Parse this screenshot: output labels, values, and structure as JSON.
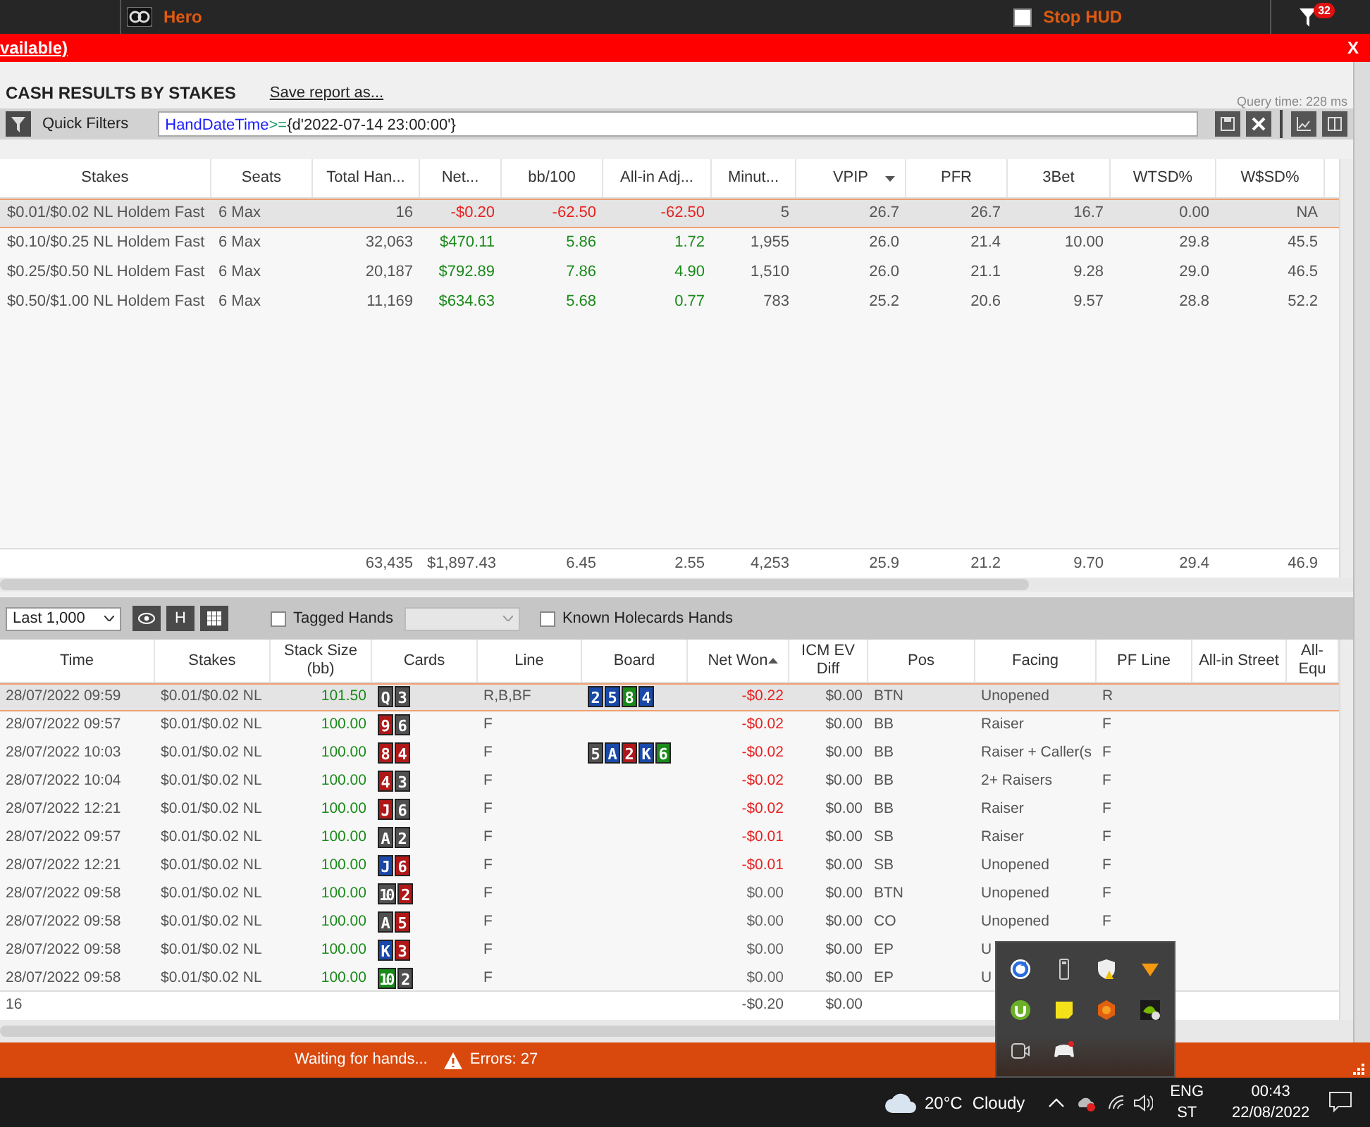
{
  "app_bar": {
    "user": "Hero",
    "stop_hud": {
      "label": "Stop HUD",
      "checked": false
    },
    "notification_count": "32"
  },
  "alert_bar": {
    "text": "vailable)",
    "close": "X"
  },
  "report": {
    "title": "CASH RESULTS BY STAKES",
    "save_link": "Save report as...",
    "query_time": "Query time: 228 ms"
  },
  "quick_filters": {
    "label": "Quick Filters",
    "tokens": [
      {
        "text": "HandDateTime",
        "kind": "field"
      },
      {
        "text": ">=",
        "kind": "operator"
      },
      {
        "text": "{d'2022-07-14 23:00:00'}",
        "kind": "literal"
      }
    ]
  },
  "stakes_table": {
    "columns": [
      {
        "label": "Stakes",
        "sorted": false
      },
      {
        "label": "Seats",
        "sorted": false
      },
      {
        "label": "Total Han...",
        "sorted": false
      },
      {
        "label": "Net...",
        "sorted": false
      },
      {
        "label": "bb/100",
        "sorted": false
      },
      {
        "label": "All-in Adj...",
        "sorted": false
      },
      {
        "label": "Minut...",
        "sorted": false
      },
      {
        "label": "VPIP",
        "sorted": true,
        "descending": true
      },
      {
        "label": "PFR",
        "sorted": false
      },
      {
        "label": "3Bet",
        "sorted": false
      },
      {
        "label": "WTSD%",
        "sorted": false
      },
      {
        "label": "W$SD%",
        "sorted": false
      }
    ],
    "rows": [
      {
        "stakes": "$0.01/$0.02 NL Holdem Fast",
        "seats": "6 Max",
        "total_hands": "16",
        "net": "-$0.20",
        "bb100": "-62.50",
        "allin_adj": "-62.50",
        "minutes": "5",
        "vpip": "26.7",
        "pfr": "26.7",
        "threebet": "16.7",
        "wtsd": "0.00",
        "wssd": "NA",
        "loss": true,
        "selected": true
      },
      {
        "stakes": "$0.10/$0.25 NL Holdem Fast",
        "seats": "6 Max",
        "total_hands": "32,063",
        "net": "$470.11",
        "bb100": "5.86",
        "allin_adj": "1.72",
        "minutes": "1,955",
        "vpip": "26.0",
        "pfr": "21.4",
        "threebet": "10.00",
        "wtsd": "29.8",
        "wssd": "45.5",
        "loss": false,
        "selected": false
      },
      {
        "stakes": "$0.25/$0.50 NL Holdem Fast",
        "seats": "6 Max",
        "total_hands": "20,187",
        "net": "$792.89",
        "bb100": "7.86",
        "allin_adj": "4.90",
        "minutes": "1,510",
        "vpip": "26.0",
        "pfr": "21.1",
        "threebet": "9.28",
        "wtsd": "29.0",
        "wssd": "46.5",
        "loss": false,
        "selected": false
      },
      {
        "stakes": "$0.50/$1.00 NL Holdem Fast",
        "seats": "6 Max",
        "total_hands": "11,169",
        "net": "$634.63",
        "bb100": "5.68",
        "allin_adj": "0.77",
        "minutes": "783",
        "vpip": "25.2",
        "pfr": "20.6",
        "threebet": "9.57",
        "wtsd": "28.8",
        "wssd": "52.2",
        "loss": false,
        "selected": false
      }
    ],
    "totals": {
      "total_hands": "63,435",
      "net": "$1,897.43",
      "bb100": "6.45",
      "allin_adj": "2.55",
      "minutes": "4,253",
      "vpip": "25.9",
      "pfr": "21.2",
      "threebet": "9.70",
      "wtsd": "29.4",
      "wssd": "46.9"
    }
  },
  "hands_toolbar": {
    "range": "Last 1,000",
    "hud_button": "H",
    "tagged": {
      "label": "Tagged Hands",
      "checked": false
    },
    "known": {
      "label": "Known Holecards Hands",
      "checked": false
    }
  },
  "hands_table": {
    "columns": [
      {
        "label": "Time",
        "sorted": false
      },
      {
        "label": "Stakes",
        "sorted": false
      },
      {
        "label": "Stack Size (bb)",
        "sorted": false
      },
      {
        "label": "Cards",
        "sorted": false
      },
      {
        "label": "Line",
        "sorted": false
      },
      {
        "label": "Board",
        "sorted": false
      },
      {
        "label": "Net Won",
        "sorted": true,
        "descending": false
      },
      {
        "label": "ICM EV Diff",
        "sorted": false
      },
      {
        "label": "Pos",
        "sorted": false
      },
      {
        "label": "Facing",
        "sorted": false
      },
      {
        "label": "PF Line",
        "sorted": false
      },
      {
        "label": "All-in Street",
        "sorted": false
      },
      {
        "label": "All- Equ",
        "sorted": false
      }
    ],
    "rows": [
      {
        "time": "28/07/2022 09:59",
        "stakes": "$0.01/$0.02 NL",
        "stack": "101.50",
        "cards": [
          {
            "rank": "Q",
            "color": "#505050"
          },
          {
            "rank": "3",
            "color": "#505050"
          }
        ],
        "line": "R,B,BF",
        "board": [
          {
            "rank": "2",
            "color": "#1848a8"
          },
          {
            "rank": "5",
            "color": "#1848a8"
          },
          {
            "rank": "8",
            "color": "#1a8a1a"
          },
          {
            "rank": "4",
            "color": "#1848a8"
          }
        ],
        "net_won": "-$0.22",
        "icm": "$0.00",
        "pos": "BTN",
        "facing": "Unopened",
        "pf_line": "R",
        "loss": true,
        "selected": true
      },
      {
        "time": "28/07/2022 09:57",
        "stakes": "$0.01/$0.02 NL",
        "stack": "100.00",
        "cards": [
          {
            "rank": "9",
            "color": "#b01818"
          },
          {
            "rank": "6",
            "color": "#505050"
          }
        ],
        "line": "F",
        "net_won": "-$0.02",
        "icm": "$0.00",
        "pos": "BB",
        "facing": "Raiser",
        "pf_line": "F",
        "loss": true,
        "selected": false
      },
      {
        "time": "28/07/2022 10:03",
        "stakes": "$0.01/$0.02 NL",
        "stack": "100.00",
        "cards": [
          {
            "rank": "8",
            "color": "#b01818"
          },
          {
            "rank": "4",
            "color": "#b01818"
          }
        ],
        "line": "F",
        "board": [
          {
            "rank": "5",
            "color": "#505050"
          },
          {
            "rank": "A",
            "color": "#1848a8"
          },
          {
            "rank": "2",
            "color": "#b01818"
          },
          {
            "rank": "K",
            "color": "#1848a8"
          },
          {
            "rank": "6",
            "color": "#1a8a1a"
          }
        ],
        "net_won": "-$0.02",
        "icm": "$0.00",
        "pos": "BB",
        "facing": "Raiser + Caller(s",
        "pf_line": "F",
        "loss": true,
        "selected": false
      },
      {
        "time": "28/07/2022 10:04",
        "stakes": "$0.01/$0.02 NL",
        "stack": "100.00",
        "cards": [
          {
            "rank": "4",
            "color": "#b01818"
          },
          {
            "rank": "3",
            "color": "#505050"
          }
        ],
        "line": "F",
        "net_won": "-$0.02",
        "icm": "$0.00",
        "pos": "BB",
        "facing": "2+ Raisers",
        "pf_line": "F",
        "loss": true,
        "selected": false
      },
      {
        "time": "28/07/2022 12:21",
        "stakes": "$0.01/$0.02 NL",
        "stack": "100.00",
        "cards": [
          {
            "rank": "J",
            "color": "#b01818"
          },
          {
            "rank": "6",
            "color": "#505050"
          }
        ],
        "line": "F",
        "net_won": "-$0.02",
        "icm": "$0.00",
        "pos": "BB",
        "facing": "Raiser",
        "pf_line": "F",
        "loss": true,
        "selected": false
      },
      {
        "time": "28/07/2022 09:57",
        "stakes": "$0.01/$0.02 NL",
        "stack": "100.00",
        "cards": [
          {
            "rank": "A",
            "color": "#505050"
          },
          {
            "rank": "2",
            "color": "#505050"
          }
        ],
        "line": "F",
        "net_won": "-$0.01",
        "icm": "$0.00",
        "pos": "SB",
        "facing": "Raiser",
        "pf_line": "F",
        "loss": true,
        "selected": false
      },
      {
        "time": "28/07/2022 12:21",
        "stakes": "$0.01/$0.02 NL",
        "stack": "100.00",
        "cards": [
          {
            "rank": "J",
            "color": "#1848a8"
          },
          {
            "rank": "6",
            "color": "#b01818"
          }
        ],
        "line": "F",
        "net_won": "-$0.01",
        "icm": "$0.00",
        "pos": "SB",
        "facing": "Unopened",
        "pf_line": "F",
        "loss": true,
        "selected": false
      },
      {
        "time": "28/07/2022 09:58",
        "stakes": "$0.01/$0.02 NL",
        "stack": "100.00",
        "cards": [
          {
            "rank": "10",
            "color": "#505050"
          },
          {
            "rank": "2",
            "color": "#b01818"
          }
        ],
        "line": "F",
        "net_won": "$0.00",
        "icm": "$0.00",
        "pos": "BTN",
        "facing": "Unopened",
        "pf_line": "F",
        "loss": false,
        "selected": false
      },
      {
        "time": "28/07/2022 09:58",
        "stakes": "$0.01/$0.02 NL",
        "stack": "100.00",
        "cards": [
          {
            "rank": "A",
            "color": "#505050"
          },
          {
            "rank": "5",
            "color": "#b01818"
          }
        ],
        "line": "F",
        "net_won": "$0.00",
        "icm": "$0.00",
        "pos": "CO",
        "facing": "Unopened",
        "pf_line": "F",
        "loss": false,
        "selected": false
      },
      {
        "time": "28/07/2022 09:58",
        "stakes": "$0.01/$0.02 NL",
        "stack": "100.00",
        "cards": [
          {
            "rank": "K",
            "color": "#1848a8"
          },
          {
            "rank": "3",
            "color": "#b01818"
          }
        ],
        "line": "F",
        "net_won": "$0.00",
        "icm": "$0.00",
        "pos": "EP",
        "facing": "U",
        "loss": false,
        "selected": false
      },
      {
        "time": "28/07/2022 09:58",
        "stakes": "$0.01/$0.02 NL",
        "stack": "100.00",
        "cards": [
          {
            "rank": "10",
            "color": "#1a8a1a"
          },
          {
            "rank": "2",
            "color": "#505050"
          }
        ],
        "line": "F",
        "net_won": "$0.00",
        "icm": "$0.00",
        "pos": "EP",
        "facing": "U",
        "loss": false,
        "selected": false
      }
    ],
    "totals": {
      "time": "16",
      "net_won": "-$0.20",
      "icm": "$0.00"
    }
  },
  "status_bar": {
    "message": "Waiting for hands...",
    "errors": "Errors: 27"
  },
  "taskbar": {
    "temperature": "20°C",
    "weather": "Cloudy",
    "language": "ENG",
    "layout": "ST",
    "time": "00:43",
    "date": "22/08/2022"
  }
}
